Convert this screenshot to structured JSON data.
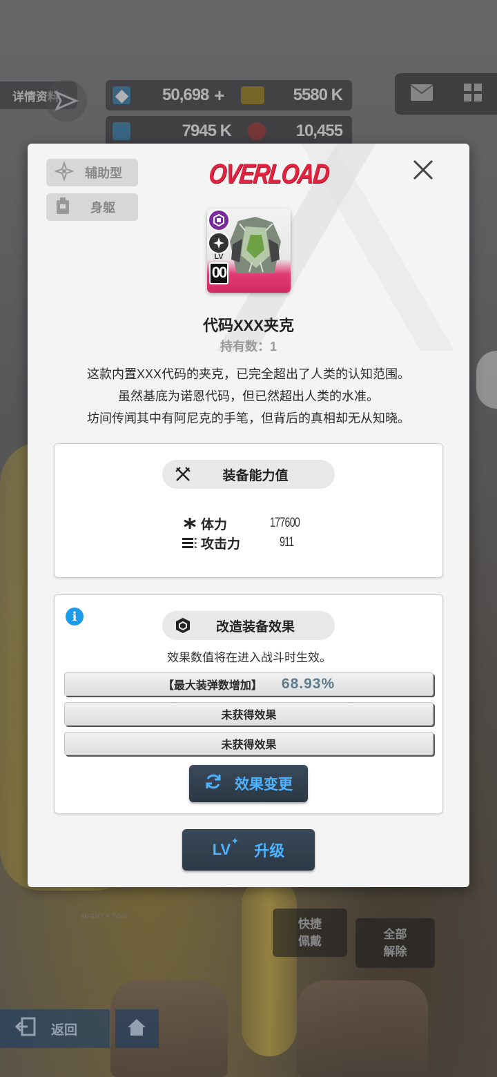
{
  "background": {
    "detail_tab": "详情资料",
    "resources": [
      {
        "icon": "crystal-icon",
        "value": "50,698"
      },
      {
        "icon": "credit-card-icon",
        "value": "5580 K"
      },
      {
        "icon": "core-dust-icon",
        "value": "7945 K"
      },
      {
        "icon": "mold-ball-icon",
        "value": "10,455"
      }
    ],
    "quick_equip": "快捷\n佩戴",
    "unequip_all": "全部\n解除",
    "back_label": "返回",
    "card_text": "MIGHTY TOO"
  },
  "modal": {
    "tags": {
      "class": "辅助型",
      "slot": "身躯"
    },
    "logo": "OVERLOAD",
    "card": {
      "lv_label": "LV",
      "lv_value": "00"
    },
    "item_name": "代码XXX夹克",
    "owned_count": "持有数：1",
    "description": [
      "这款内置XXX代码的夹克，已完全超出了人类的认知范围。",
      "虽然基底为诺恩代码，但已然超出人类的水准。",
      "坊间传闻其中有阿尼克的手笔，但背后的真相却无从知晓。"
    ],
    "stats_panel": {
      "header": "装备能力值",
      "stats": [
        {
          "icon": "hp-icon",
          "label": "体力",
          "value": "177600"
        },
        {
          "icon": "attack-icon",
          "label": "攻击力",
          "value": "911"
        }
      ]
    },
    "effects_panel": {
      "header": "改造装备效果",
      "note": "效果数值将在进入战斗时生效。",
      "effects": [
        {
          "label": "【最大装弹数增加】",
          "value": "68.93%"
        },
        {
          "label": "未获得效果",
          "value": ""
        },
        {
          "label": "未获得效果",
          "value": ""
        }
      ],
      "change_button": "效果变更"
    },
    "upgrade_button": {
      "lv": "LV",
      "label": "升级"
    }
  },
  "colors": {
    "overload_red": "#e0243f",
    "button_blue_text": "#4db3ff",
    "info_blue": "#1e9be8",
    "card_pink": "#e23a74"
  }
}
